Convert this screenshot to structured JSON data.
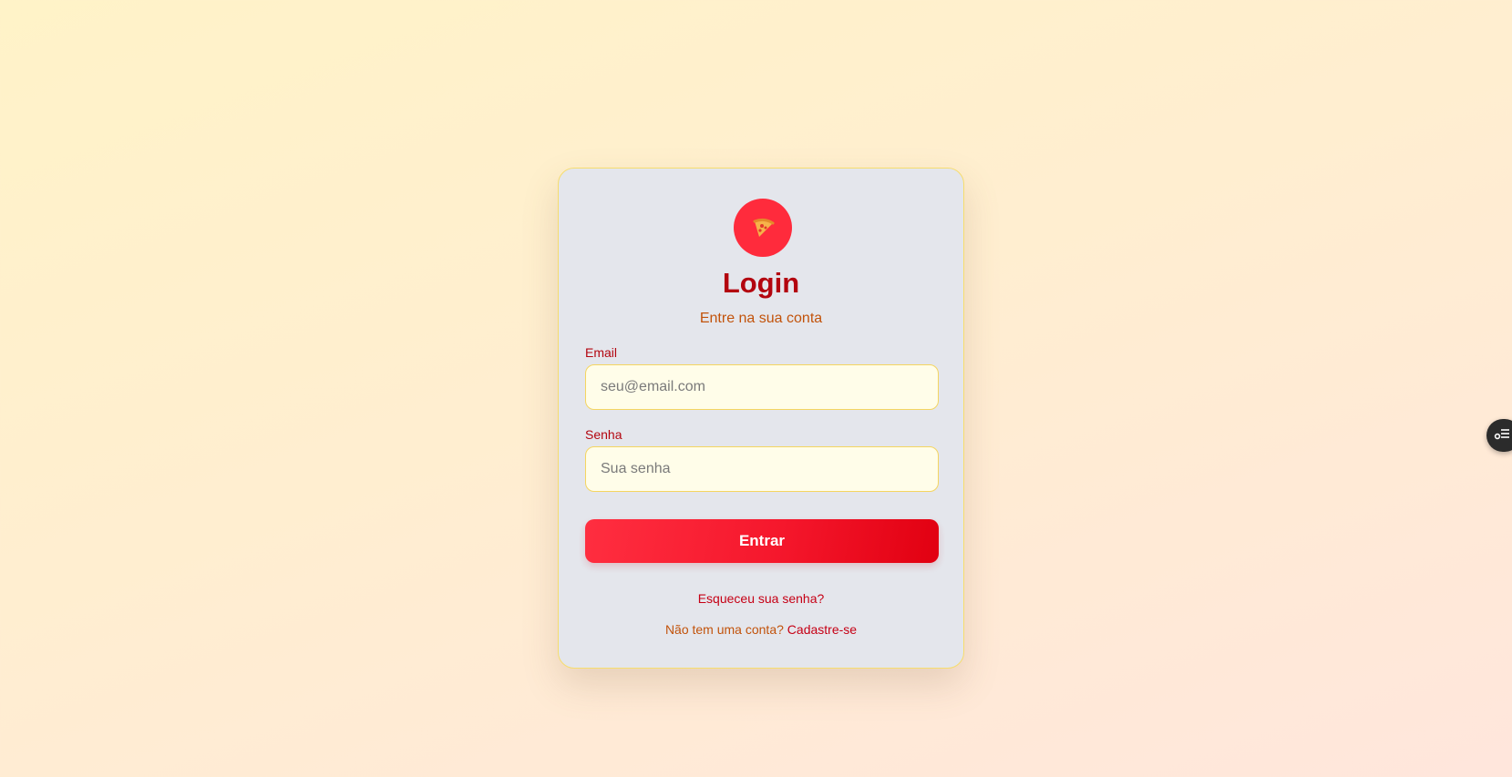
{
  "login": {
    "logo_icon": "pizza-slice-icon",
    "title": "Login",
    "subtitle": "Entre na sua conta",
    "email_label": "Email",
    "email_placeholder": "seu@email.com",
    "email_value": "",
    "password_label": "Senha",
    "password_placeholder": "Sua senha",
    "password_value": "",
    "submit_label": "Entrar",
    "forgot_link": "Esqueceu sua senha?",
    "signup_prompt": "Não tem uma conta?",
    "signup_link": "Cadastre-se"
  },
  "side_widget": {
    "icon": "settings-list-icon"
  },
  "colors": {
    "primary_red": "#ff2b3c",
    "title_red": "#b3050f",
    "accent_orange": "#c2530b",
    "input_border": "#f4d561",
    "input_bg": "#fffde9",
    "card_bg": "#e4e6ec"
  }
}
